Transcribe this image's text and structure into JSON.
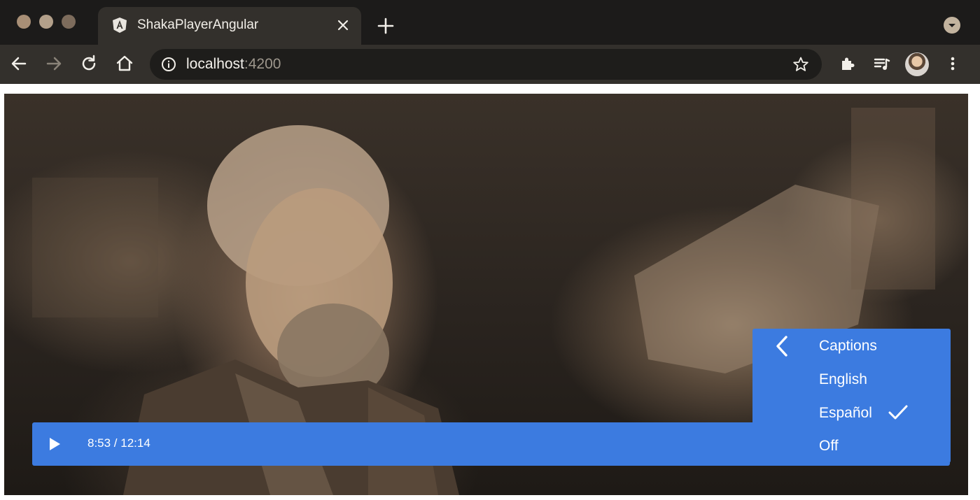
{
  "browser": {
    "tab": {
      "title": "ShakaPlayerAngular",
      "favicon": "angular-logo-icon"
    },
    "address_bar": {
      "host": "localhost",
      "port": ":4200"
    },
    "icons": [
      "back-icon",
      "forward-icon",
      "reload-icon",
      "home-icon",
      "info-icon",
      "star-icon",
      "extensions-icon",
      "media-control-icon",
      "menu-icon"
    ]
  },
  "player": {
    "time": "8:53 / 12:14",
    "progress": 0.727,
    "accent_color": "#3c7be0",
    "captions_menu": {
      "title": "Captions",
      "options": [
        "English",
        "Español",
        "Off"
      ],
      "selected": "Español"
    }
  }
}
